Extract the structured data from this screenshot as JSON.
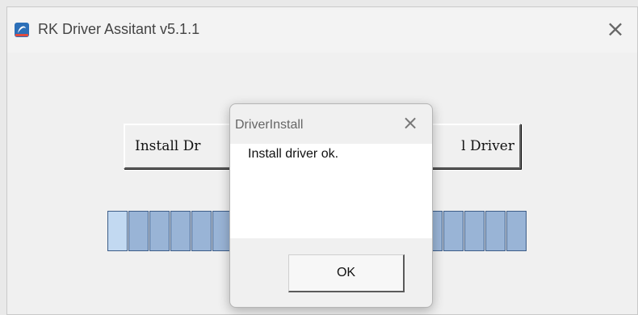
{
  "window": {
    "title": "RK Driver Assitant v5.1.1",
    "close_glyph": "×",
    "icon": "app-logo-icon"
  },
  "buttons": {
    "install_visible": "Install Dr",
    "uninstall_visible": "l Driver"
  },
  "progress": {
    "segments_visible": 20,
    "highlighted_segment": 1,
    "fill_color": "#99b4d6",
    "highlight_color": "#c2d9f1"
  },
  "dialog": {
    "title": "DriverInstall",
    "close_glyph": "×",
    "message": "Install driver ok.",
    "ok_label": "OK"
  }
}
